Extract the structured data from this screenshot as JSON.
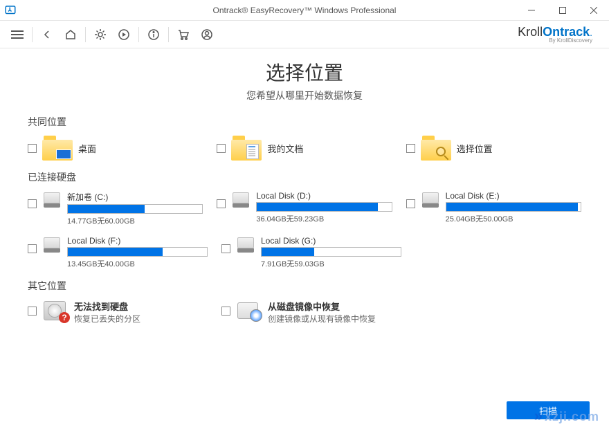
{
  "window": {
    "title": "Ontrack® EasyRecovery™ Windows Professional"
  },
  "brand": {
    "prefix": "Kroll",
    "main": "Ontrack",
    "byline": "By KrollDiscovery"
  },
  "page": {
    "title": "选择位置",
    "subtitle": "您希望从哪里开始数据恢复"
  },
  "sections": {
    "common": "共同位置",
    "drives": "已连接硬盘",
    "other": "其它位置"
  },
  "common_locations": {
    "desktop": "桌面",
    "documents": "我的文档",
    "choose": "选择位置"
  },
  "drives": [
    {
      "name": "新加卷 (C:)",
      "stats": "14.77GB无60.00GB",
      "fill": 57
    },
    {
      "name": "Local Disk (D:)",
      "stats": "36.04GB无59.23GB",
      "fill": 90
    },
    {
      "name": "Local Disk (E:)",
      "stats": "25.04GB无50.00GB",
      "fill": 98
    },
    {
      "name": "Local Disk (F:)",
      "stats": "13.45GB无40.00GB",
      "fill": 68
    },
    {
      "name": "Local Disk (G:)",
      "stats": "7.91GB无59.03GB",
      "fill": 38
    }
  ],
  "other": {
    "lost_title": "无法找到硬盘",
    "lost_sub": "恢复已丢失的分区",
    "image_title": "从磁盘镜像中恢复",
    "image_sub": "创建镜像或从现有镜像中恢复"
  },
  "scan_button": "扫描",
  "watermark": "xzji.com"
}
